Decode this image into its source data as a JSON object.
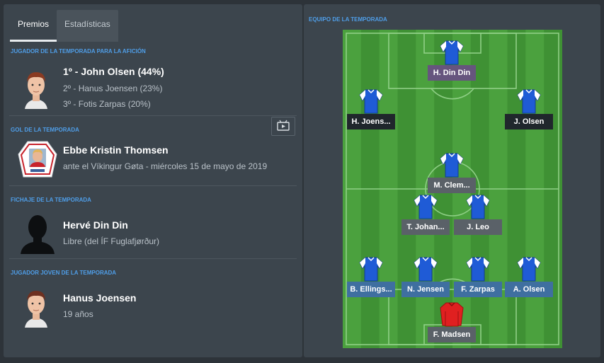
{
  "tabs": [
    {
      "label": "Premios",
      "active": true
    },
    {
      "label": "Estadísticas",
      "active": false
    }
  ],
  "awards": {
    "fans_player": {
      "section": "JUGADOR DE LA TEMPORADA PARA LA AFICIÓN",
      "first": "1º - John Olsen (44%)",
      "second": "2º - Hanus Joensen (23%)",
      "third": "3º - Fotis Zarpas (20%)"
    },
    "goal": {
      "section": "GOL DE LA TEMPORADA",
      "name": "Ebbe Kristin Thomsen",
      "detail": "ante el Víkingur Gøta - miércoles 15 de mayo de 2019",
      "video_icon": "video-play-icon"
    },
    "signing": {
      "section": "FICHAJE DE LA TEMPORADA",
      "name": "Hervé Din Din",
      "detail": "Libre (del ÍF Fuglafjørður)"
    },
    "young": {
      "section": "JUGADOR JOVEN DE LA TEMPORADA",
      "name": "Hanus Joensen",
      "detail": "19 años"
    }
  },
  "team_of_season": {
    "title": "EQUIPO DE LA TEMPORADA",
    "players": [
      {
        "name": "H. Din Din",
        "label_style": "purple",
        "kit": "blue"
      },
      {
        "name": "H. Joens...",
        "label_style": "dark",
        "kit": "blue"
      },
      {
        "name": "J. Olsen",
        "label_style": "dark",
        "kit": "blue"
      },
      {
        "name": "M. Clem...",
        "label_style": "grey",
        "kit": "blue"
      },
      {
        "name": "T. Johan...",
        "label_style": "grey",
        "kit": "blue"
      },
      {
        "name": "J. Leo",
        "label_style": "grey",
        "kit": "blue"
      },
      {
        "name": "B. Ellings...",
        "label_style": "blue",
        "kit": "blue"
      },
      {
        "name": "N. Jensen",
        "label_style": "blue",
        "kit": "blue"
      },
      {
        "name": "F. Zarpas",
        "label_style": "blue",
        "kit": "blue"
      },
      {
        "name": "A. Olsen",
        "label_style": "blue",
        "kit": "blue"
      },
      {
        "name": "F. Madsen",
        "label_style": "grey",
        "kit": "red"
      }
    ]
  },
  "colors": {
    "accent": "#4f9ee8",
    "pitch_light": "#4ba13e",
    "pitch_dark": "#3f9134",
    "kit_blue": "#1f5bd6",
    "kit_red": "#e02020"
  }
}
